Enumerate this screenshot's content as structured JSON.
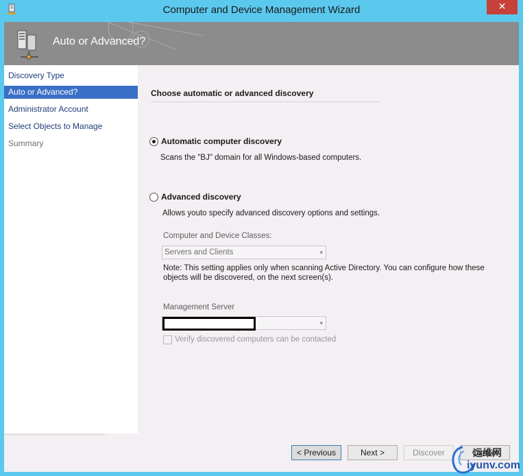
{
  "window": {
    "title": "Computer and Device Management Wizard",
    "close_glyph": "✕"
  },
  "banner": {
    "title": "Auto or Advanced?"
  },
  "nav": {
    "items": [
      {
        "label": "Discovery Type"
      },
      {
        "label": "Auto or Advanced?"
      },
      {
        "label": "Administrator Account"
      },
      {
        "label": "Select Objects to Manage"
      },
      {
        "label": "Summary"
      }
    ]
  },
  "content": {
    "heading": "Choose automatic or advanced discovery",
    "automatic": {
      "label": "Automatic computer discovery",
      "description": "Scans the \"BJ\" domain for all Windows-based computers.",
      "selected": true
    },
    "advanced": {
      "label": "Advanced discovery",
      "description": "Allows youto specify advanced discovery options and settings.",
      "selected": false,
      "classes_label": "Computer and Device Classes:",
      "classes_value": "Servers and Clients",
      "note_line1": "Note: This setting applies only when scanning Active Directory.  You can configure how these",
      "note_line2": "objects will be discovered, on the next screen(s).",
      "server_label": "Management Server",
      "verify_label": "Verify discovered computers can be contacted"
    }
  },
  "footer": {
    "previous": "< Previous",
    "next": "Next >",
    "discover": "Discover",
    "cancel": "Cancel"
  },
  "watermark": {
    "cn": "运维网",
    "url": "iyunv.com"
  }
}
